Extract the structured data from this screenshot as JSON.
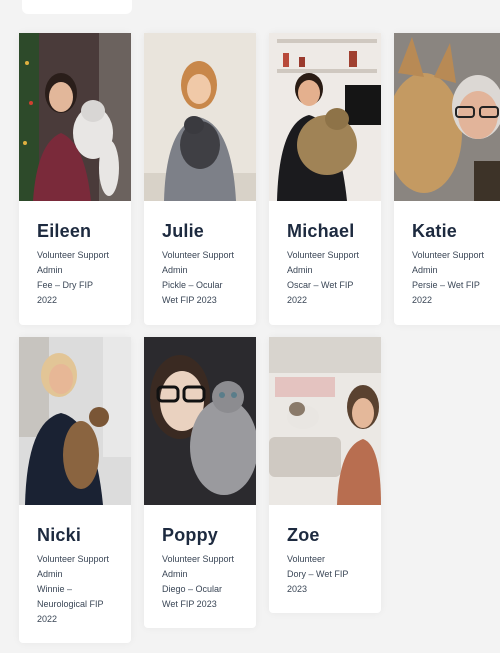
{
  "team": [
    {
      "name": "Eileen",
      "lines": [
        "Volunteer Support",
        "Admin",
        "Fee – Dry FIP",
        "2022"
      ]
    },
    {
      "name": "Julie",
      "lines": [
        "Volunteer Support",
        "Admin",
        "Pickle – Ocular",
        "Wet FIP 2023"
      ]
    },
    {
      "name": "Michael",
      "lines": [
        "Volunteer Support",
        "Admin",
        "Oscar – Wet FIP",
        "2022"
      ]
    },
    {
      "name": "Katie",
      "lines": [
        "Volunteer Support",
        "Admin",
        "Persie – Wet FIP",
        "2022"
      ]
    },
    {
      "name": "Nicki",
      "lines": [
        "Volunteer Support",
        "Admin",
        "Winnie –",
        "Neurological FIP",
        "2022"
      ]
    },
    {
      "name": "Poppy",
      "lines": [
        "Volunteer Support",
        "Admin",
        "Diego – Ocular",
        "Wet FIP 2023"
      ]
    },
    {
      "name": "Zoe",
      "lines": [
        "Volunteer",
        "Dory – Wet FIP",
        "2023"
      ]
    }
  ]
}
